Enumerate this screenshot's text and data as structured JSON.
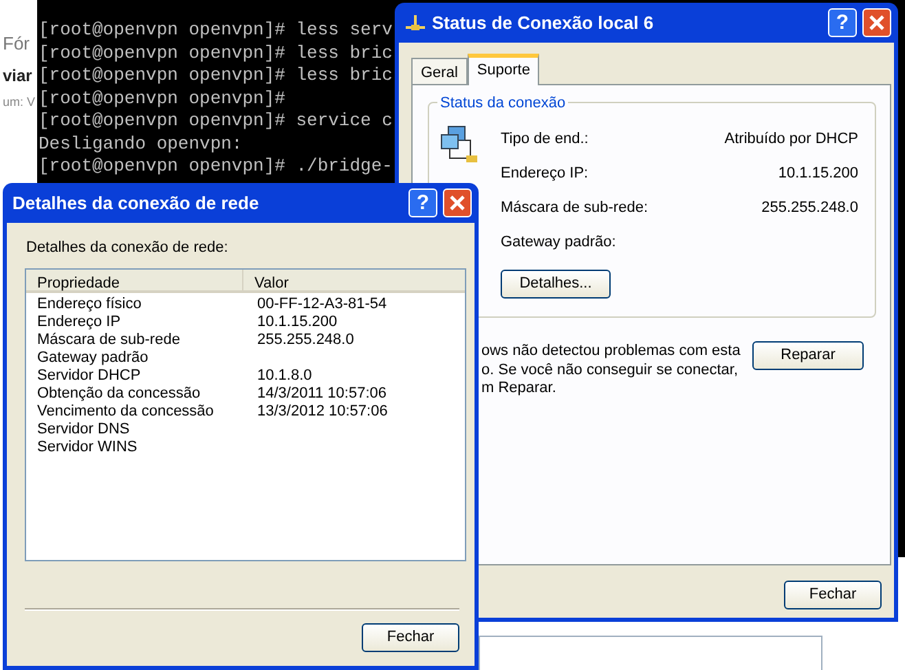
{
  "background_page": {
    "texts": [
      {
        "text": "Fór",
        "kind": "link"
      },
      {
        "text": "viar",
        "kind": "heading"
      },
      {
        "text": "um: V",
        "kind": "meta"
      }
    ]
  },
  "terminal": {
    "lines": [
      "[root@openvpn openvpn]# less serv",
      "[root@openvpn openvpn]# less bric",
      "[root@openvpn openvpn]# less bric",
      "[root@openvpn openvpn]#",
      "[root@openvpn openvpn]# service c",
      "Desligando openvpn:",
      "[root@openvpn openvpn]# ./bridge-"
    ]
  },
  "status_window": {
    "title": "Status de Conexão local 6",
    "help_button": "?",
    "tabs": [
      {
        "label": "Geral",
        "selected": false
      },
      {
        "label": "Suporte",
        "selected": true
      }
    ],
    "group_title": "Status da conexão",
    "fields": [
      {
        "label": "Tipo de end.:",
        "value": "Atribuído por DHCP"
      },
      {
        "label": "Endereço IP:",
        "value": "10.1.15.200"
      },
      {
        "label": "Máscara de sub-rede:",
        "value": "255.255.248.0"
      },
      {
        "label": "Gateway padrão:"
      }
    ],
    "details_button": "Detalhes...",
    "repair_text": [
      "ows não detectou problemas com esta",
      "o. Se você não conseguir se conectar,",
      "m Reparar."
    ],
    "repair_button": "Reparar",
    "close_button": "Fechar"
  },
  "details_window": {
    "title": "Detalhes da conexão de rede",
    "help_button": "?",
    "caption": "Detalhes da conexão de rede:",
    "columns": [
      "Propriedade",
      "Valor"
    ],
    "rows": [
      {
        "property": "Endereço físico",
        "value": "00-FF-12-A3-81-54"
      },
      {
        "property": "Endereço IP",
        "value": "10.1.15.200"
      },
      {
        "property": "Máscara de sub-rede",
        "value": "255.255.248.0"
      },
      {
        "property": "Gateway padrão"
      },
      {
        "property": "Servidor DHCP",
        "value": "10.1.8.0"
      },
      {
        "property": "Obtenção da concessão",
        "value": "14/3/2011 10:57:06"
      },
      {
        "property": "Vencimento da concessão",
        "value": "13/3/2012 10:57:06"
      },
      {
        "property": "Servidor DNS"
      },
      {
        "property": "Servidor WINS"
      }
    ],
    "close_button": "Fechar"
  }
}
